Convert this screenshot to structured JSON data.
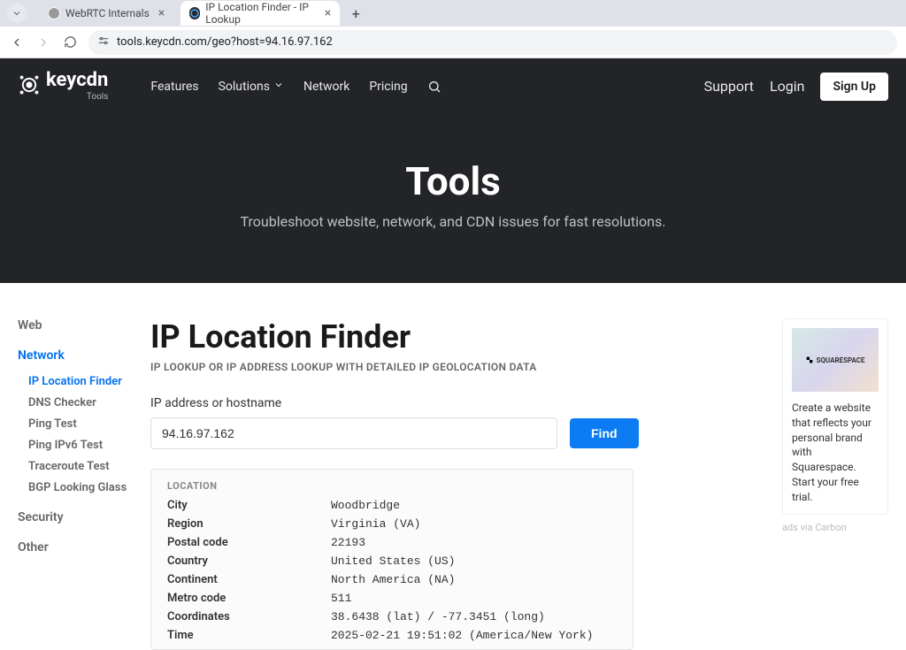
{
  "browser": {
    "tabs": [
      {
        "title": "WebRTC Internals"
      },
      {
        "title": "IP Location Finder - IP Lookup"
      }
    ],
    "url": "tools.keycdn.com/geo?host=94.16.97.162"
  },
  "header": {
    "brand": "keycdn",
    "brand_sub": "Tools",
    "nav": {
      "features": "Features",
      "solutions": "Solutions",
      "network": "Network",
      "pricing": "Pricing"
    },
    "support": "Support",
    "login": "Login",
    "signup": "Sign Up"
  },
  "hero": {
    "title": "Tools",
    "subtitle": "Troubleshoot website, network, and CDN issues for fast resolutions."
  },
  "sidebar": {
    "web": "Web",
    "network": "Network",
    "security": "Security",
    "other": "Other",
    "items": [
      {
        "label": "IP Location Finder"
      },
      {
        "label": "DNS Checker"
      },
      {
        "label": "Ping Test"
      },
      {
        "label": "Ping IPv6 Test"
      },
      {
        "label": "Traceroute Test"
      },
      {
        "label": "BGP Looking Glass"
      }
    ]
  },
  "page": {
    "title": "IP Location Finder",
    "subtitle": "IP LOOKUP OR IP ADDRESS LOOKUP WITH DETAILED IP GEOLOCATION DATA",
    "form_label": "IP address or hostname",
    "input_value": "94.16.97.162",
    "find_button": "Find"
  },
  "result": {
    "heading": "LOCATION",
    "rows": [
      {
        "k": "City",
        "v": "Woodbridge"
      },
      {
        "k": "Region",
        "v": "Virginia (VA)"
      },
      {
        "k": "Postal code",
        "v": "22193"
      },
      {
        "k": "Country",
        "v": "United States (US)"
      },
      {
        "k": "Continent",
        "v": "North America (NA)"
      },
      {
        "k": "Metro code",
        "v": "511"
      },
      {
        "k": "Coordinates",
        "v": "38.6438 (lat) / -77.3451 (long)"
      },
      {
        "k": "Time",
        "v": "2025-02-21 19:51:02 (America/New York)"
      }
    ]
  },
  "ad": {
    "brand": "SQUARESPACE",
    "text": "Create a website that reflects your personal brand with Squarespace. Start your free trial.",
    "via": "ads via Carbon"
  }
}
